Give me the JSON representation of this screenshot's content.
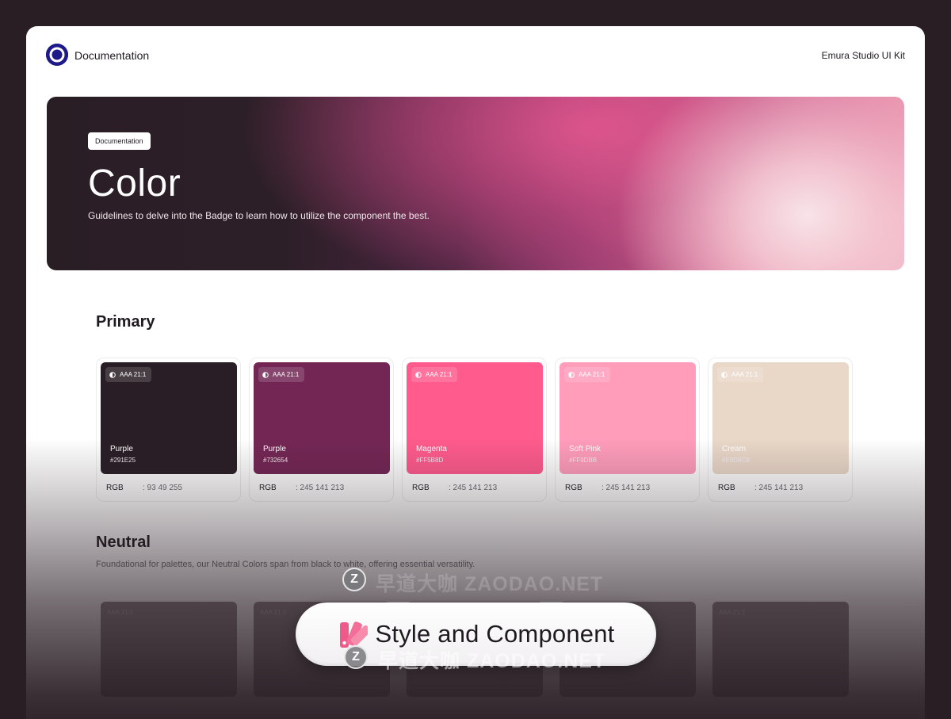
{
  "header": {
    "brand_title": "Documentation",
    "kit_name": "Emura Studio UI Kit"
  },
  "hero": {
    "badge": "Documentation",
    "title": "Color",
    "subtitle": "Guidelines to delve into the Badge to learn how to utilize the component the best."
  },
  "primary": {
    "title": "Primary",
    "cards": [
      {
        "contrast": "AAA 21:1",
        "name": "Purple",
        "hex": "#291E25",
        "rgb_label": "RGB",
        "rgb_value": ": 93 49 255",
        "color": "#291e25"
      },
      {
        "contrast": "AAA 21:1",
        "name": "Purple",
        "hex": "#732654",
        "rgb_label": "RGB",
        "rgb_value": ": 245 141 213",
        "color": "#732654"
      },
      {
        "contrast": "AAA 21:1",
        "name": "Magenta",
        "hex": "#FF5B8D",
        "rgb_label": "RGB",
        "rgb_value": ": 245 141 213",
        "color": "#ff5b8d"
      },
      {
        "contrast": "AAA 21:1",
        "name": "Soft Pink",
        "hex": "#FF9DBB",
        "rgb_label": "RGB",
        "rgb_value": ": 245 141 213",
        "color": "#ff9dbb"
      },
      {
        "contrast": "AAA 21:1",
        "name": "Cream",
        "hex": "#E9D8C8",
        "rgb_label": "RGB",
        "rgb_value": ": 245 141 213",
        "color": "#e9d8c8"
      }
    ]
  },
  "neutral": {
    "title": "Neutral",
    "description": "Foundational for palettes, our Neutral Colors span from black to white, offering essential versatility.",
    "ghost_badges": [
      "AAA 21:1",
      "AAA 21:1",
      "AAA 21:1"
    ]
  },
  "overlay": {
    "pill_text": "Style and Component",
    "watermark_letter": "Z",
    "watermark_text": "早道大咖 ZAODAO.NET"
  },
  "colors": {
    "background": "#2a1e25",
    "logo": "#1e1a8a"
  }
}
